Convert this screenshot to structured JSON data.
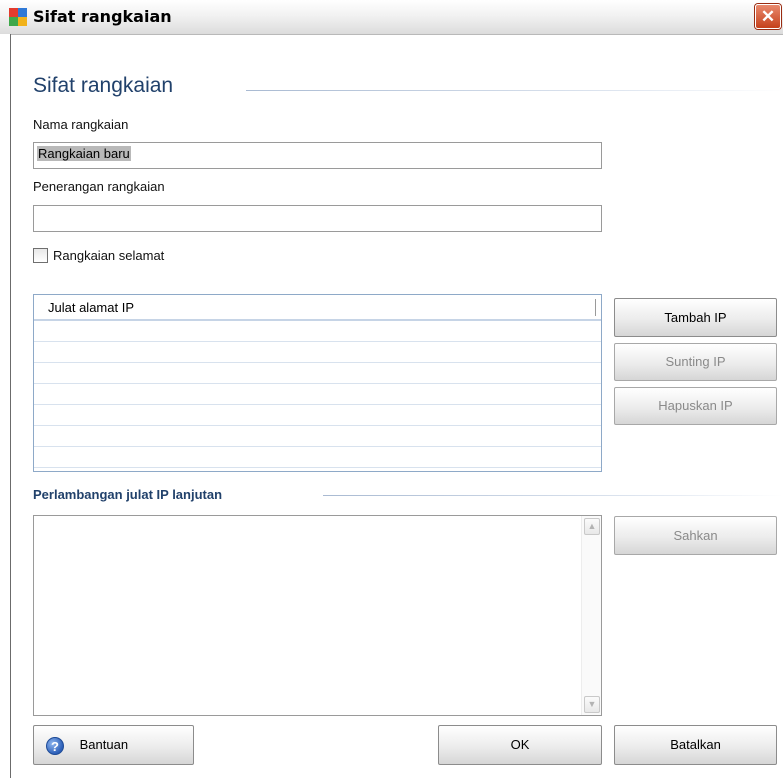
{
  "window": {
    "title": "Sifat rangkaian",
    "close_glyph": "✕"
  },
  "header": {
    "title": "Sifat rangkaian"
  },
  "form": {
    "name_label": "Nama rangkaian",
    "name_value": "Rangkaian baru",
    "desc_label": "Penerangan rangkaian",
    "desc_value": "",
    "safe_label": "Rangkaian selamat",
    "safe_checked": false
  },
  "ip_list": {
    "column_header": "Julat alamat IP",
    "rows": [],
    "add_button": "Tambah IP",
    "edit_button": "Sunting IP",
    "delete_button": "Hapuskan IP"
  },
  "advanced": {
    "title": "Perlambangan julat IP lanjutan",
    "text": "",
    "apply_button": "Sahkan",
    "scroll_up": "▲",
    "scroll_down": "▼"
  },
  "footer": {
    "help_button": "Bantuan",
    "help_icon_glyph": "?",
    "ok_button": "OK",
    "cancel_button": "Batalkan"
  },
  "colors": {
    "accent": "#21416b",
    "list_border": "#8ea9c8"
  },
  "icons": [
    "app-icon",
    "close-icon",
    "help-icon",
    "scroll-up-icon",
    "scroll-down-icon"
  ]
}
